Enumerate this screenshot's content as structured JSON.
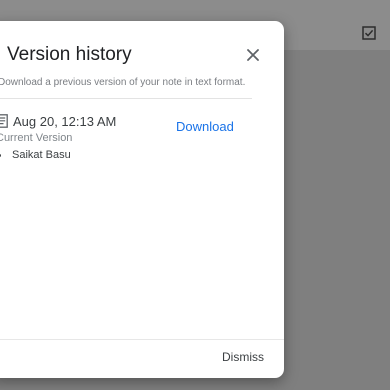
{
  "background": {
    "checkbox_icon": "checked-checkbox-icon"
  },
  "dialog": {
    "title": "Version history",
    "subtitle": "Download a previous version of your note in text format.",
    "close_icon": "close-icon",
    "version": {
      "icon": "document-icon",
      "date": "Aug 20, 12:13 AM",
      "status": "Current Version",
      "authors": [
        "Saikat Basu"
      ],
      "download_label": "Download"
    },
    "dismiss_label": "Dismiss"
  },
  "colors": {
    "accent": "#1a73e8",
    "overlay": "#7f7f7f",
    "dialog_bg": "#ffffff"
  }
}
